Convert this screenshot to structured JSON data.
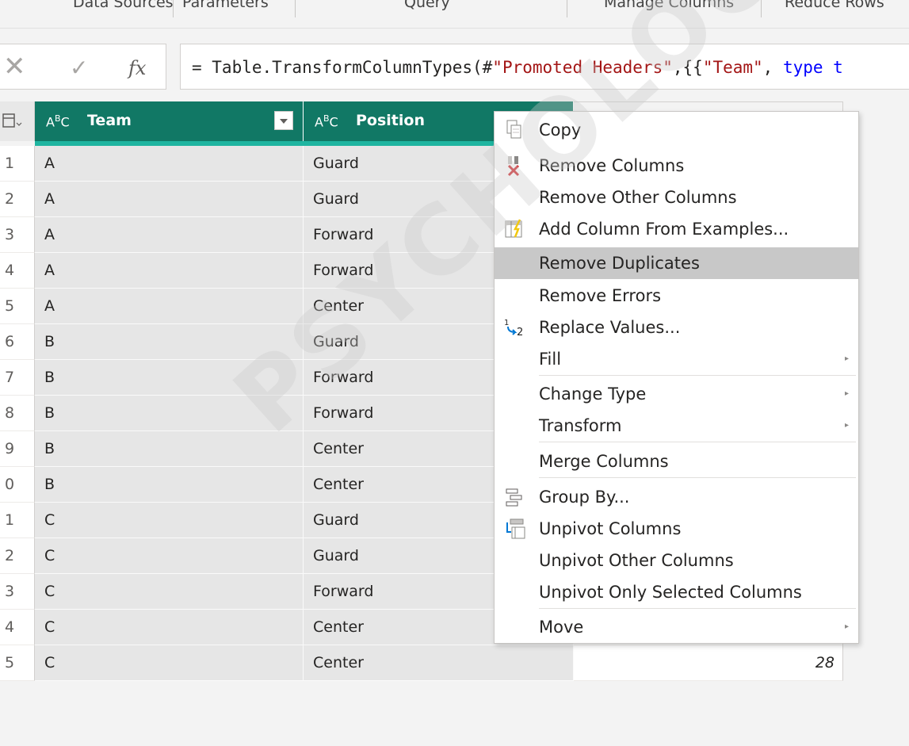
{
  "ribbon": {
    "groups": [
      "Data Sources",
      "Parameters",
      "Query",
      "Manage Columns",
      "Reduce Rows"
    ]
  },
  "formula_bar": {
    "fx_label": "fx",
    "formula_prefix": "= Table.TransformColumnTypes(#",
    "formula_str1": "\"Promoted Headers\"",
    "formula_mid": ",{{",
    "formula_str2": "\"Team\"",
    "formula_sep": ", ",
    "formula_kw": "type t"
  },
  "columns": [
    {
      "type_label": "ABC",
      "name": "Team"
    },
    {
      "type_label": "ABC",
      "name": "Position"
    }
  ],
  "rows": [
    {
      "num": "1",
      "team": "A",
      "position": "Guard"
    },
    {
      "num": "2",
      "team": "A",
      "position": "Guard"
    },
    {
      "num": "3",
      "team": "A",
      "position": "Forward"
    },
    {
      "num": "4",
      "team": "A",
      "position": "Forward"
    },
    {
      "num": "5",
      "team": "A",
      "position": "Center"
    },
    {
      "num": "6",
      "team": "B",
      "position": "Guard"
    },
    {
      "num": "7",
      "team": "B",
      "position": "Forward"
    },
    {
      "num": "8",
      "team": "B",
      "position": "Forward"
    },
    {
      "num": "9",
      "team": "B",
      "position": "Center"
    },
    {
      "num": "0",
      "team": "B",
      "position": "Center"
    },
    {
      "num": "1",
      "team": "C",
      "position": "Guard"
    },
    {
      "num": "2",
      "team": "C",
      "position": "Guard"
    },
    {
      "num": "3",
      "team": "C",
      "position": "Forward"
    },
    {
      "num": "4",
      "team": "C",
      "position": "Center"
    },
    {
      "num": "5",
      "team": "C",
      "position": "Center"
    }
  ],
  "last_row_value": "28",
  "context_menu": {
    "items": [
      {
        "label": "Copy",
        "icon": "copy-icon"
      },
      {
        "label": "Remove Columns",
        "icon": "remove-columns-icon"
      },
      {
        "label": "Remove Other Columns"
      },
      {
        "label": "Add Column From Examples...",
        "icon": "column-from-examples-icon"
      },
      {
        "label": "Remove Duplicates",
        "highlighted": true
      },
      {
        "label": "Remove Errors"
      },
      {
        "label": "Replace Values...",
        "icon": "replace-values-icon"
      },
      {
        "label": "Fill",
        "submenu": true
      },
      {
        "label": "Change Type",
        "submenu": true
      },
      {
        "label": "Transform",
        "submenu": true
      },
      {
        "label": "Merge Columns"
      },
      {
        "label": "Group By...",
        "icon": "group-by-icon"
      },
      {
        "label": "Unpivot Columns",
        "icon": "unpivot-icon"
      },
      {
        "label": "Unpivot Other Columns"
      },
      {
        "label": "Unpivot Only Selected Columns"
      },
      {
        "label": "Move",
        "submenu": true
      }
    ]
  },
  "watermark": "PSYCHOLOGY.COM",
  "colors": {
    "header_bg": "#117865",
    "quality_bar": "#1fb5a0",
    "highlight": "#c8c8c8"
  }
}
